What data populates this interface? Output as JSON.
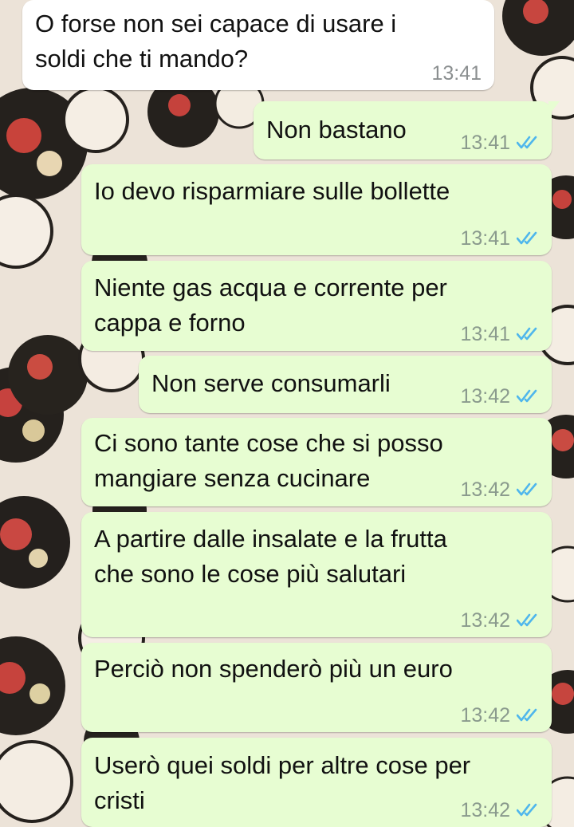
{
  "colors": {
    "incoming_bubble": "#ffffff",
    "outgoing_bubble": "#e7fdd2",
    "read_ticks": "#4fb6ec",
    "timestamp": "#8a9a8d"
  },
  "messages": [
    {
      "direction": "in",
      "text": "O forse non sei capace di usare i\nsoldi che ti mando?",
      "time": "13:41",
      "status_icon": ""
    },
    {
      "direction": "out",
      "text": "Non bastano",
      "time": "13:41",
      "status_icon": "double-check-read-icon"
    },
    {
      "direction": "out",
      "text": "Io devo risparmiare sulle bollette",
      "time": "13:41",
      "status_icon": "double-check-read-icon"
    },
    {
      "direction": "out",
      "text": "Niente gas acqua e corrente per\ncappa e forno",
      "time": "13:41",
      "status_icon": "double-check-read-icon"
    },
    {
      "direction": "out",
      "text": "Non serve consumarli",
      "time": "13:42",
      "status_icon": "double-check-read-icon"
    },
    {
      "direction": "out",
      "text": "Ci sono tante cose che si posso\nmangiare senza cucinare",
      "time": "13:42",
      "status_icon": "double-check-read-icon"
    },
    {
      "direction": "out",
      "text": "A partire dalle insalate e la frutta\nche sono le cose più salutari",
      "time": "13:42",
      "status_icon": "double-check-read-icon"
    },
    {
      "direction": "out",
      "text": "Perciò non spenderò più un euro",
      "time": "13:42",
      "status_icon": "double-check-read-icon"
    },
    {
      "direction": "out",
      "text": "Userò quei soldi per altre cose per\ncristi",
      "time": "13:42",
      "status_icon": "double-check-read-icon"
    }
  ]
}
